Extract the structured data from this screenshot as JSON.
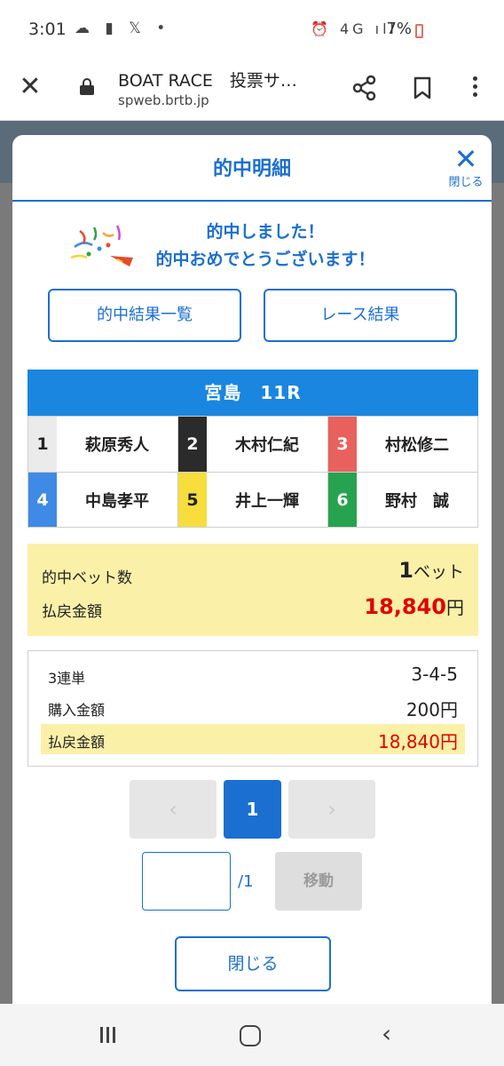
{
  "status_bar": {
    "time": "3:01",
    "left_icons": "☁ ▮ 𝕏 •",
    "network": "⏰ 4G ıll",
    "battery": "7%"
  },
  "browser": {
    "title": "BOAT RACE　投票サ…",
    "url": "spweb.brtb.jp"
  },
  "modal": {
    "title": "的中明細",
    "close_label": "閉じる",
    "congrats_line1": "的中しました！",
    "congrats_line2": "的中おめでとうございます！",
    "btn_hit_list": "的中結果一覧",
    "btn_race_result": "レース結果",
    "race_header": "宮島　11R",
    "racers": [
      {
        "num": "1",
        "name": "萩原秀人",
        "bg": "#ebebeb",
        "fg": "#222222"
      },
      {
        "num": "2",
        "name": "木村仁紀",
        "bg": "#2b2b2b",
        "fg": "#ffffff"
      },
      {
        "num": "3",
        "name": "村松修二",
        "bg": "#e8615e",
        "fg": "#ffffff"
      },
      {
        "num": "4",
        "name": "中島孝平",
        "bg": "#3f8ae6",
        "fg": "#ffffff"
      },
      {
        "num": "5",
        "name": "井上一輝",
        "bg": "#f7de3d",
        "fg": "#222222"
      },
      {
        "num": "6",
        "name": "野村　誠",
        "bg": "#27a34f",
        "fg": "#ffffff"
      }
    ],
    "summary": {
      "hit_bets_label": "的中ベット数",
      "hit_bets_value": "1",
      "hit_bets_unit": "ベット",
      "payout_label": "払戻金額",
      "payout_value": "18,840",
      "payout_unit": "円"
    },
    "detail": {
      "bet_type": "3連単",
      "combination": "3-4-5",
      "purchase_label": "購入金額",
      "purchase_value": "200円",
      "payout_label": "払戻金額",
      "payout_value": "18,840円"
    },
    "pager": {
      "prev": "‹",
      "current": "1",
      "next": "›",
      "total": "/1",
      "go_label": "移動"
    },
    "bottom_close": "閉じる"
  },
  "nav": {
    "back": "‹"
  }
}
